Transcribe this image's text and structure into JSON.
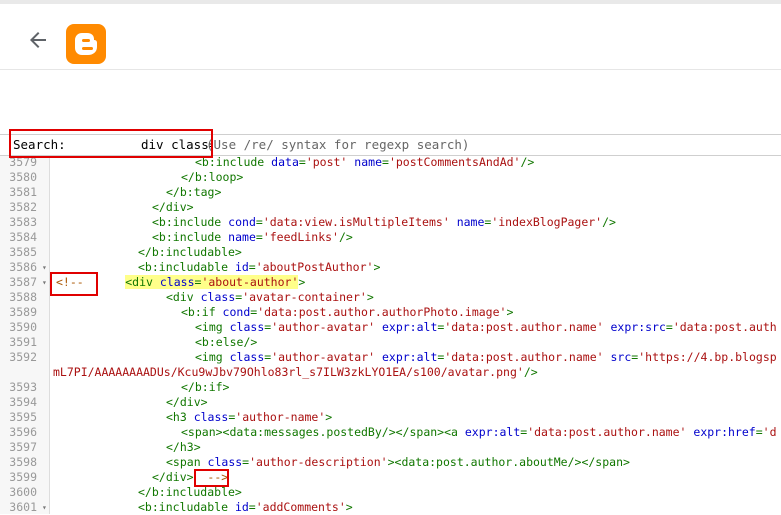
{
  "app": {
    "logo_icon": "blogger-logo-icon",
    "back_icon": "back-arrow-icon"
  },
  "search": {
    "label": "Search:",
    "value": "div class='about-au",
    "hint": "(Use /re/ syntax for regexp search)"
  },
  "colors": {
    "tag": "#117700",
    "attr": "#0000cc",
    "string": "#aa1111",
    "highlight": "#ffff8a",
    "annotation": "#e00000",
    "logo": "#ff8a00"
  },
  "lines": [
    {
      "n": "3579",
      "fold": "",
      "segs": [
        [
          "t",
          "<b:include "
        ],
        [
          "a",
          "data"
        ],
        [
          "t",
          "="
        ],
        [
          "s",
          "'post'"
        ],
        [
          "t",
          " "
        ],
        [
          "a",
          "name"
        ],
        [
          "t",
          "="
        ],
        [
          "s",
          "'postCommentsAndAd'"
        ],
        [
          "t",
          "/>"
        ]
      ]
    },
    {
      "n": "3580",
      "fold": "",
      "segs": [
        [
          "t",
          "</b:loop>"
        ]
      ]
    },
    {
      "n": "3581",
      "fold": "",
      "segs": [
        [
          "t",
          "</b:tag>"
        ]
      ]
    },
    {
      "n": "3582",
      "fold": "",
      "segs": [
        [
          "t",
          "</div>"
        ]
      ]
    },
    {
      "n": "3583",
      "fold": "",
      "segs": [
        [
          "t",
          "<b:include "
        ],
        [
          "a",
          "cond"
        ],
        [
          "t",
          "="
        ],
        [
          "s",
          "'data:view.isMultipleItems'"
        ],
        [
          "t",
          " "
        ],
        [
          "a",
          "name"
        ],
        [
          "t",
          "="
        ],
        [
          "s",
          "'indexBlogPager'"
        ],
        [
          "t",
          "/>"
        ]
      ]
    },
    {
      "n": "3584",
      "fold": "",
      "segs": [
        [
          "t",
          "<b:include "
        ],
        [
          "a",
          "name"
        ],
        [
          "t",
          "="
        ],
        [
          "s",
          "'feedLinks'"
        ],
        [
          "t",
          "/>"
        ]
      ]
    },
    {
      "n": "3585",
      "fold": "",
      "segs": [
        [
          "t",
          "</b:includable>"
        ]
      ]
    },
    {
      "n": "3586",
      "fold": "▾",
      "segs": [
        [
          "t",
          "<b:includable "
        ],
        [
          "a",
          "id"
        ],
        [
          "t",
          "="
        ],
        [
          "s",
          "'aboutPostAuthor'"
        ],
        [
          "t",
          ">"
        ]
      ]
    },
    {
      "n": "3587",
      "fold": "▾",
      "segs": [
        [
          "c",
          "<!--"
        ],
        [
          "t",
          "      "
        ],
        [
          "th",
          "<div "
        ],
        [
          "ah",
          "class"
        ],
        [
          "th",
          "="
        ],
        [
          "sh",
          "'about-author'"
        ],
        [
          "t",
          ">"
        ]
      ]
    },
    {
      "n": "3588",
      "fold": "",
      "segs": [
        [
          "t",
          "<div "
        ],
        [
          "a",
          "class"
        ],
        [
          "t",
          "="
        ],
        [
          "s",
          "'avatar-container'"
        ],
        [
          "t",
          ">"
        ]
      ]
    },
    {
      "n": "3589",
      "fold": "",
      "segs": [
        [
          "t",
          "<b:if "
        ],
        [
          "a",
          "cond"
        ],
        [
          "t",
          "="
        ],
        [
          "s",
          "'data:post.author.authorPhoto.image'"
        ],
        [
          "t",
          ">"
        ]
      ]
    },
    {
      "n": "3590",
      "fold": "",
      "segs": [
        [
          "t",
          "<img "
        ],
        [
          "a",
          "class"
        ],
        [
          "t",
          "="
        ],
        [
          "s",
          "'author-avatar'"
        ],
        [
          "t",
          " "
        ],
        [
          "a",
          "expr:alt"
        ],
        [
          "t",
          "="
        ],
        [
          "s",
          "'data:post.author.name'"
        ],
        [
          "t",
          " "
        ],
        [
          "a",
          "expr:src"
        ],
        [
          "t",
          "="
        ],
        [
          "s",
          "'data:post.auth"
        ]
      ]
    },
    {
      "n": "3591",
      "fold": "",
      "segs": [
        [
          "t",
          "<b:else/>"
        ]
      ]
    },
    {
      "n": "3592",
      "fold": "",
      "segs": [
        [
          "t",
          "<img "
        ],
        [
          "a",
          "class"
        ],
        [
          "t",
          "="
        ],
        [
          "s",
          "'author-avatar'"
        ],
        [
          "t",
          " "
        ],
        [
          "a",
          "expr:alt"
        ],
        [
          "t",
          "="
        ],
        [
          "s",
          "'data:post.author.name'"
        ],
        [
          "t",
          " "
        ],
        [
          "a",
          "src"
        ],
        [
          "t",
          "="
        ],
        [
          "s",
          "'https://4.bp.blogsp"
        ]
      ]
    },
    {
      "n": "",
      "fold": "",
      "segs": [
        [
          "s",
          "mL7PI/AAAAAAAADUs/Kcu9wJbv79Ohlo83rl_s7ILW3zkLYO1EA/s100/avatar.png'"
        ],
        [
          "t",
          "/>"
        ]
      ]
    },
    {
      "n": "3593",
      "fold": "",
      "segs": [
        [
          "t",
          "</b:if>"
        ]
      ]
    },
    {
      "n": "3594",
      "fold": "",
      "segs": [
        [
          "t",
          "</div>"
        ]
      ]
    },
    {
      "n": "3595",
      "fold": "",
      "segs": [
        [
          "t",
          "<h3 "
        ],
        [
          "a",
          "class"
        ],
        [
          "t",
          "="
        ],
        [
          "s",
          "'author-name'"
        ],
        [
          "t",
          ">"
        ]
      ]
    },
    {
      "n": "3596",
      "fold": "",
      "segs": [
        [
          "t",
          "<span><data:messages.postedBy/></span><a "
        ],
        [
          "a",
          "expr:alt"
        ],
        [
          "t",
          "="
        ],
        [
          "s",
          "'data:post.author.name'"
        ],
        [
          "t",
          " "
        ],
        [
          "a",
          "expr:href"
        ],
        [
          "t",
          "="
        ],
        [
          "s",
          "'d"
        ]
      ]
    },
    {
      "n": "3597",
      "fold": "",
      "segs": [
        [
          "t",
          "</h3>"
        ]
      ]
    },
    {
      "n": "3598",
      "fold": "",
      "segs": [
        [
          "t",
          "<span "
        ],
        [
          "a",
          "class"
        ],
        [
          "t",
          "="
        ],
        [
          "s",
          "'author-description'"
        ],
        [
          "t",
          "><data:post.author.aboutMe/></span>"
        ]
      ]
    },
    {
      "n": "3599",
      "fold": "",
      "segs": [
        [
          "t",
          "</div>"
        ],
        [
          "t",
          "  "
        ],
        [
          "c",
          "-->"
        ]
      ]
    },
    {
      "n": "3600",
      "fold": "",
      "segs": [
        [
          "t",
          "</b:includable>"
        ]
      ]
    },
    {
      "n": "3601",
      "fold": "▾",
      "segs": [
        [
          "t",
          "<b:includable "
        ],
        [
          "a",
          "id"
        ],
        [
          "t",
          "="
        ],
        [
          "s",
          "'addComments'"
        ],
        [
          "t",
          ">"
        ]
      ]
    }
  ]
}
